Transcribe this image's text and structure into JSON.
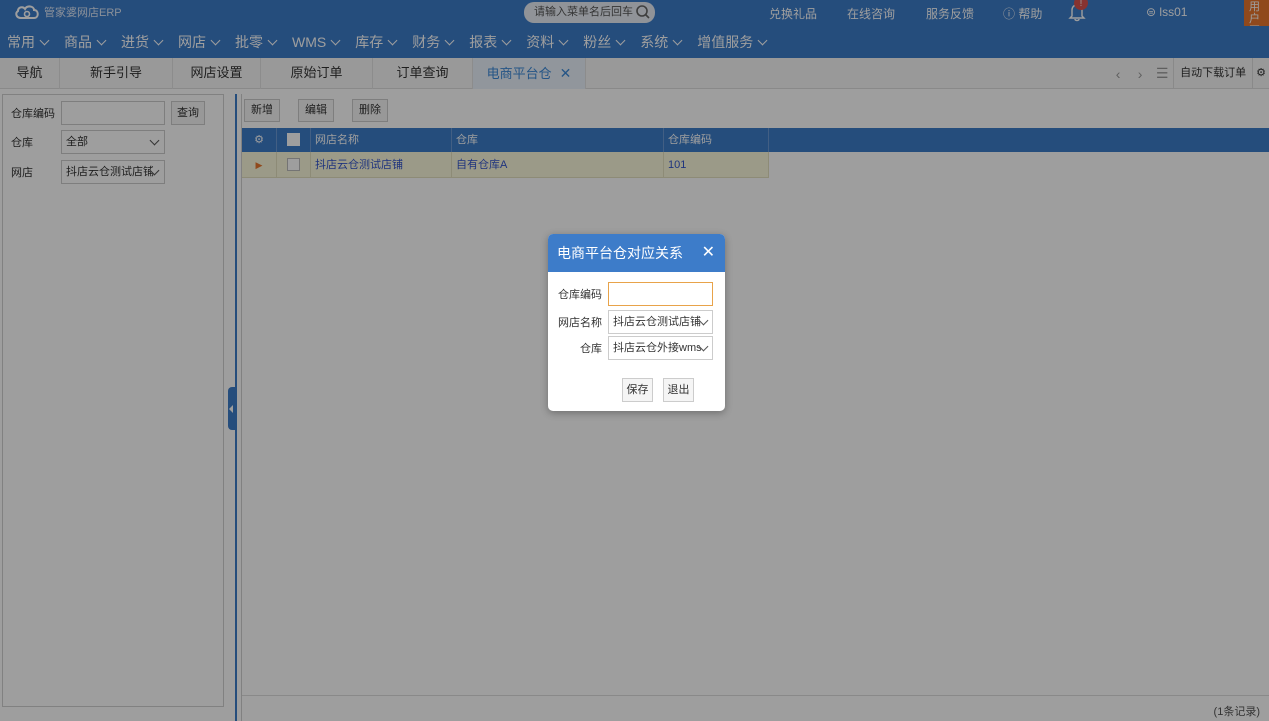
{
  "app": {
    "logo_text": "管家婆网店ERP"
  },
  "topbar": {
    "search_placeholder": "请输入菜单名后回车",
    "links": [
      "兑换礼品",
      "在线咨询",
      "服务反馈",
      "帮助"
    ],
    "notification_count": "!",
    "user": "lss01",
    "corner_label": "用户互动"
  },
  "menu": [
    "常用",
    "商品",
    "进货",
    "网店",
    "批零",
    "WMS",
    "库存",
    "财务",
    "报表",
    "资料",
    "粉丝",
    "系统",
    "增值服务"
  ],
  "tabs": [
    {
      "label": "导航"
    },
    {
      "label": "新手引导"
    },
    {
      "label": "网店设置"
    },
    {
      "label": "原始订单"
    },
    {
      "label": "订单查询"
    },
    {
      "label": "电商平台仓"
    }
  ],
  "tab_tools": {
    "auto_download": "自动下载订单"
  },
  "filter": {
    "code_label": "仓库编码",
    "code_value": "",
    "query_button": "查询",
    "warehouse_label": "仓库",
    "warehouse_value": "全部",
    "shop_label": "网店",
    "shop_value": "抖店云仓测试店铺"
  },
  "toolbar": {
    "add": "新增",
    "edit": "编辑",
    "delete": "删除"
  },
  "grid": {
    "columns": [
      "网店名称",
      "仓库",
      "仓库编码"
    ],
    "rows": [
      {
        "shop": "抖店云仓测试店铺",
        "warehouse": "自有仓库A",
        "code": "101"
      }
    ],
    "record_count": "(1条记录)"
  },
  "dialog": {
    "title": "电商平台仓对应关系",
    "code_label": "仓库编码",
    "code_value": "",
    "shop_label": "网店名称",
    "shop_value": "抖店云仓测试店铺",
    "warehouse_label": "仓库",
    "warehouse_value": "抖店云仓外接wms",
    "save": "保存",
    "exit": "退出"
  },
  "colors": {
    "primary": "#3d7cc9",
    "row_highlight": "#fbf8dc",
    "accent_orange": "#e8772e",
    "link_blue": "#3355cc"
  }
}
